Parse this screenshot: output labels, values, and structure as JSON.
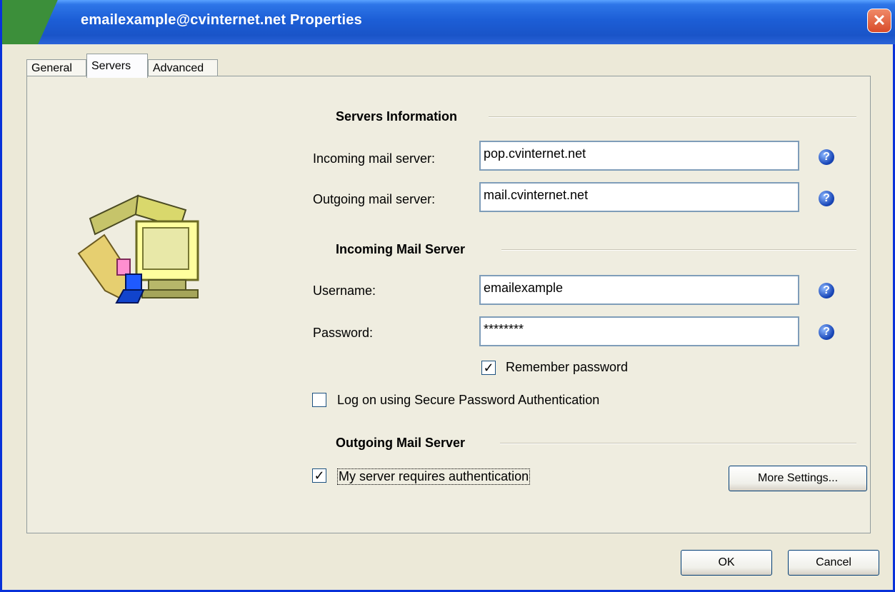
{
  "window": {
    "title": "emailexample@cvinternet.net Properties"
  },
  "tabs": [
    {
      "label": "General"
    },
    {
      "label": "Servers"
    },
    {
      "label": "Advanced"
    }
  ],
  "sections": {
    "servers_info": "Servers Information",
    "incoming_mail_server": "Incoming Mail Server",
    "outgoing_mail_server": "Outgoing Mail Server"
  },
  "fields": {
    "incoming_label": "Incoming mail server:",
    "incoming_value": "pop.cvinternet.net",
    "outgoing_label": "Outgoing mail server:",
    "outgoing_value": "mail.cvinternet.net",
    "username_label": "Username:",
    "username_value": "emailexample",
    "password_label": "Password:",
    "password_value": "********"
  },
  "checkboxes": {
    "remember_password": {
      "label": "Remember password",
      "checked": true
    },
    "secure_auth": {
      "label": "Log on using Secure Password Authentication",
      "checked": false
    },
    "server_requires_auth": {
      "label": "My server requires authentication",
      "checked": true
    }
  },
  "buttons": {
    "more_settings": "More Settings...",
    "ok": "OK",
    "cancel": "Cancel"
  },
  "icons": {
    "help": "help-icon",
    "close": "close-icon",
    "illustration": "mailbox-computer-icon"
  },
  "colors": {
    "titlebar": "#2e76e8",
    "close": "#d84b2a",
    "background": "#ece9d8"
  }
}
